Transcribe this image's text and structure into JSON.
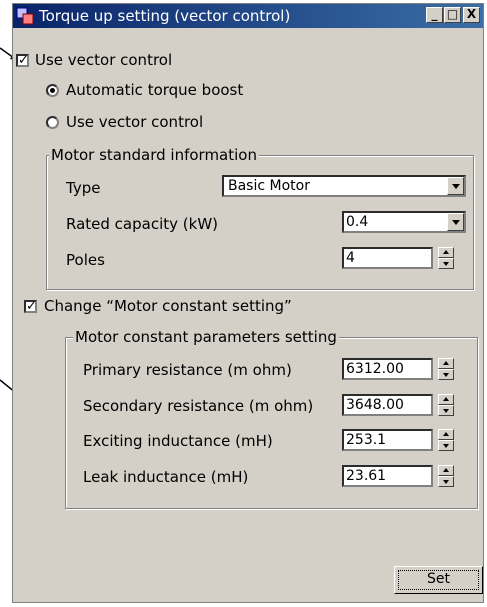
{
  "window": {
    "title": "Torque up setting (vector control)"
  },
  "controls": {
    "use_vector_checkbox": {
      "label": "Use vector control",
      "checked": true
    },
    "radio_auto": {
      "label": "Automatic torque boost",
      "selected": true
    },
    "radio_vector": {
      "label": "Use vector control",
      "selected": false
    }
  },
  "motor_info": {
    "title": "Motor standard information",
    "type_label": "Type",
    "type_value": "Basic Motor",
    "capacity_label": "Rated capacity (kW)",
    "capacity_value": "0.4",
    "poles_label": "Poles",
    "poles_value": "4"
  },
  "change_checkbox": {
    "label": "Change “Motor constant setting”",
    "checked": true
  },
  "motor_params": {
    "title": "Motor constant parameters setting",
    "rows": [
      {
        "label": "Primary resistance (m ohm)",
        "value": "6312.00"
      },
      {
        "label": "Secondary resistance (m ohm)",
        "value": "3648.00"
      },
      {
        "label": "Exciting inductance (mH)",
        "value": "253.1"
      },
      {
        "label": "Leak inductance (mH)",
        "value": "23.61"
      }
    ]
  },
  "buttons": {
    "set": "Set",
    "minimize": "_",
    "maximize": "□",
    "close": "X"
  }
}
